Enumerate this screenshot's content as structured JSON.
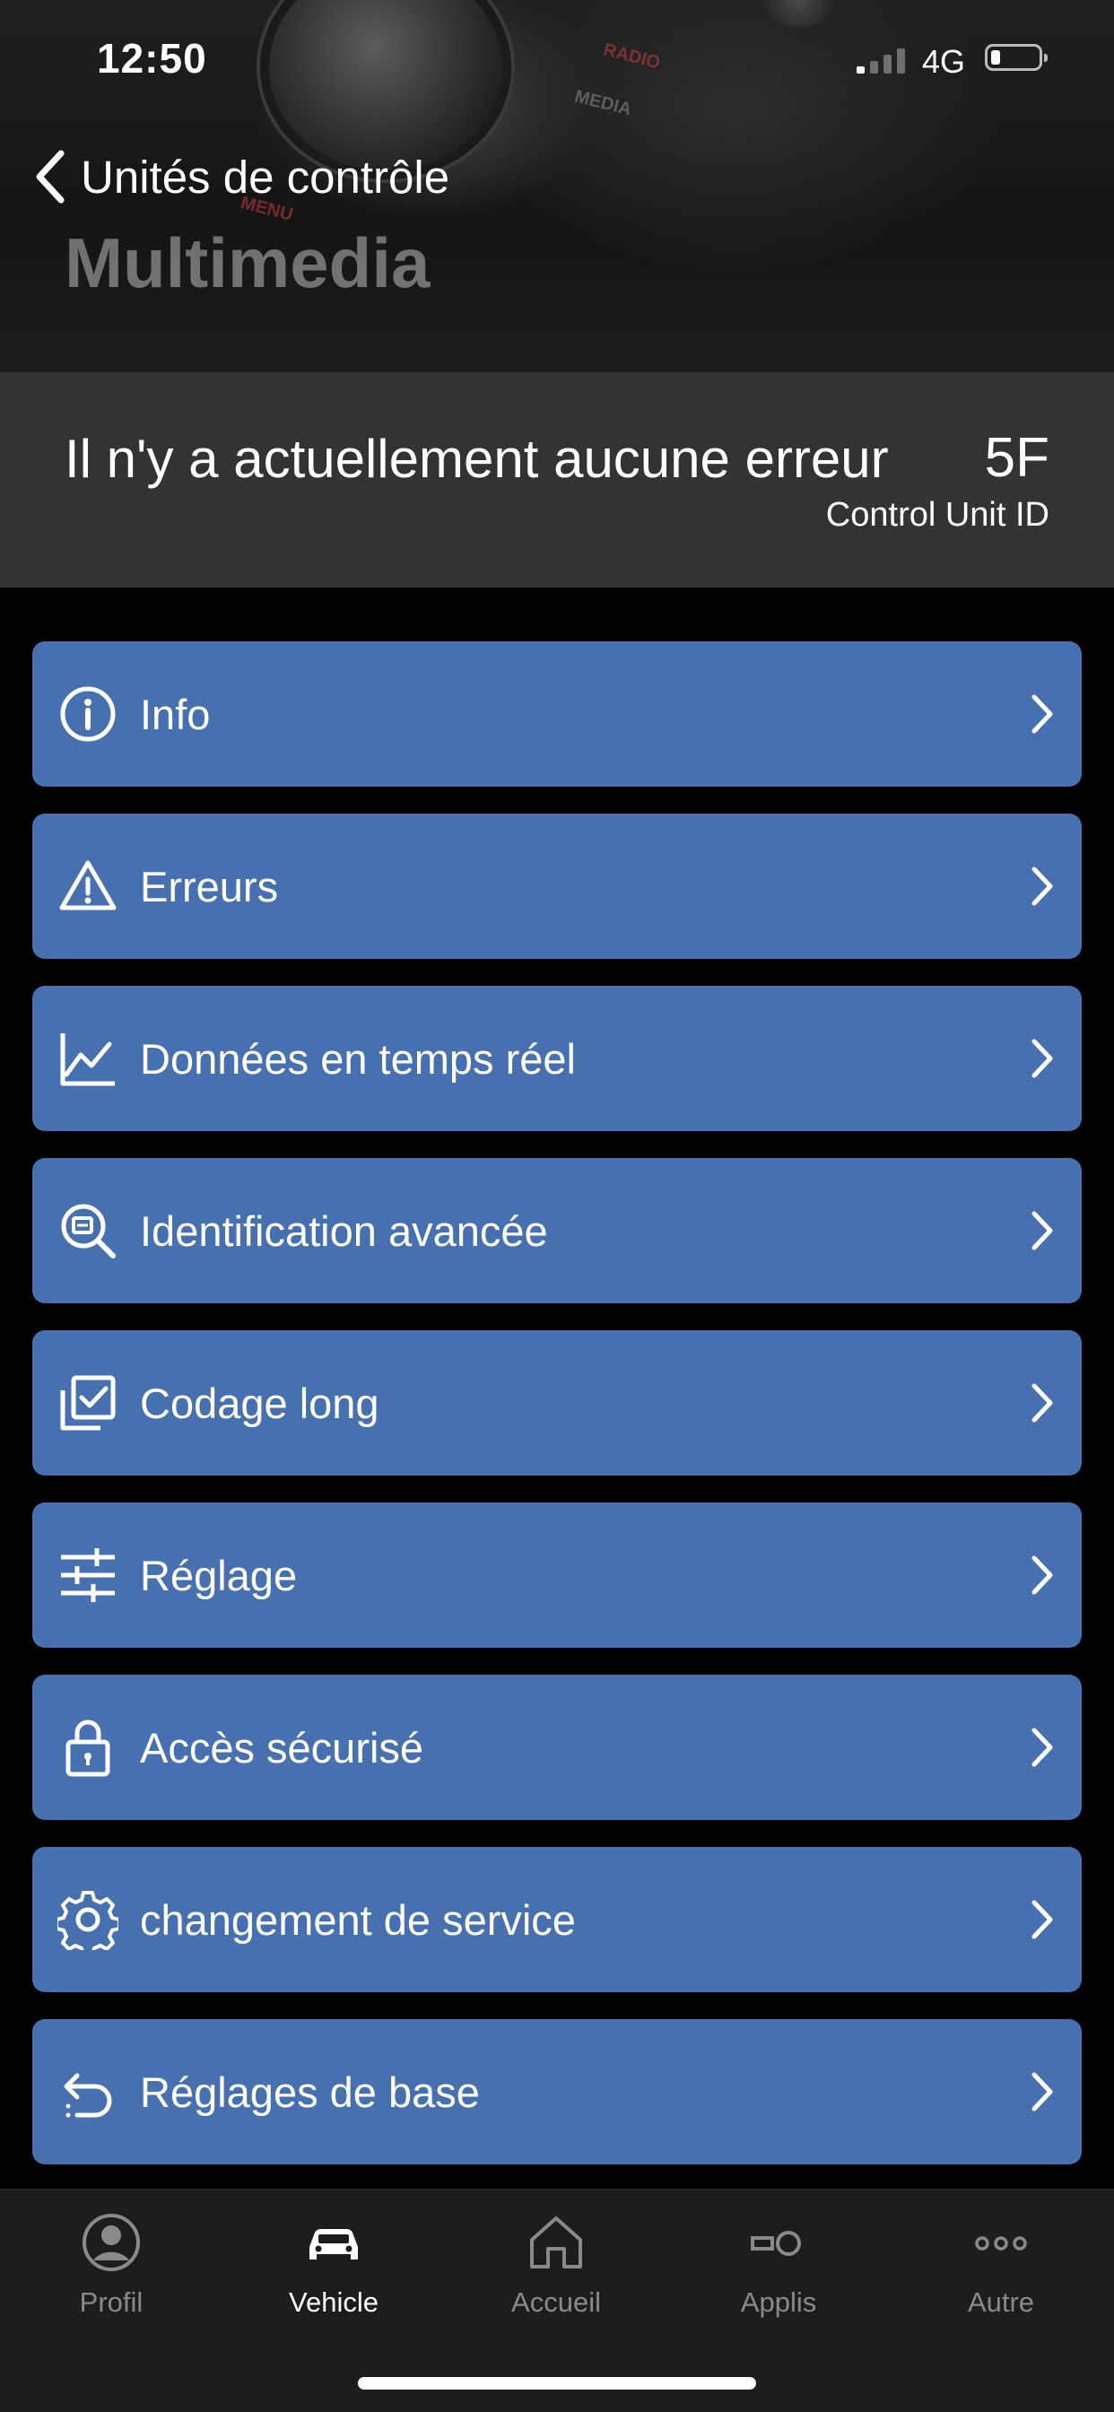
{
  "status_bar": {
    "time": "12:50",
    "network": "4G",
    "battery_level": 0.2
  },
  "header": {
    "back_label": "Unités de contrôle",
    "title": "Multimedia",
    "decor": {
      "radio": "RADIO",
      "media": "MEDIA",
      "menu": "MENU"
    }
  },
  "error_panel": {
    "message": "Il n'y a actuellement aucune erreur",
    "unit_id_value": "5F",
    "unit_id_label": "Control Unit ID"
  },
  "menu": {
    "items": [
      {
        "label": "Info",
        "icon": "info-icon"
      },
      {
        "label": "Erreurs",
        "icon": "warning-icon"
      },
      {
        "label": "Données en temps réel",
        "icon": "line-chart-icon"
      },
      {
        "label": "Identification avancée",
        "icon": "search-id-icon"
      },
      {
        "label": "Codage long",
        "icon": "checklist-icon"
      },
      {
        "label": "Réglage",
        "icon": "sliders-icon"
      },
      {
        "label": "Accès sécurisé",
        "icon": "lock-icon"
      },
      {
        "label": "changement de service",
        "icon": "gear-icon"
      },
      {
        "label": "Réglages de base",
        "icon": "undo-icon"
      }
    ],
    "item_color": "#4670B0"
  },
  "tabbar": {
    "tabs": [
      {
        "label": "Profil",
        "icon": "profile-icon",
        "active": false
      },
      {
        "label": "Vehicle",
        "icon": "car-icon",
        "active": true
      },
      {
        "label": "Accueil",
        "icon": "home-icon",
        "active": false
      },
      {
        "label": "Applis",
        "icon": "apps-icon",
        "active": false
      },
      {
        "label": "Autre",
        "icon": "more-icon",
        "active": false
      }
    ]
  }
}
